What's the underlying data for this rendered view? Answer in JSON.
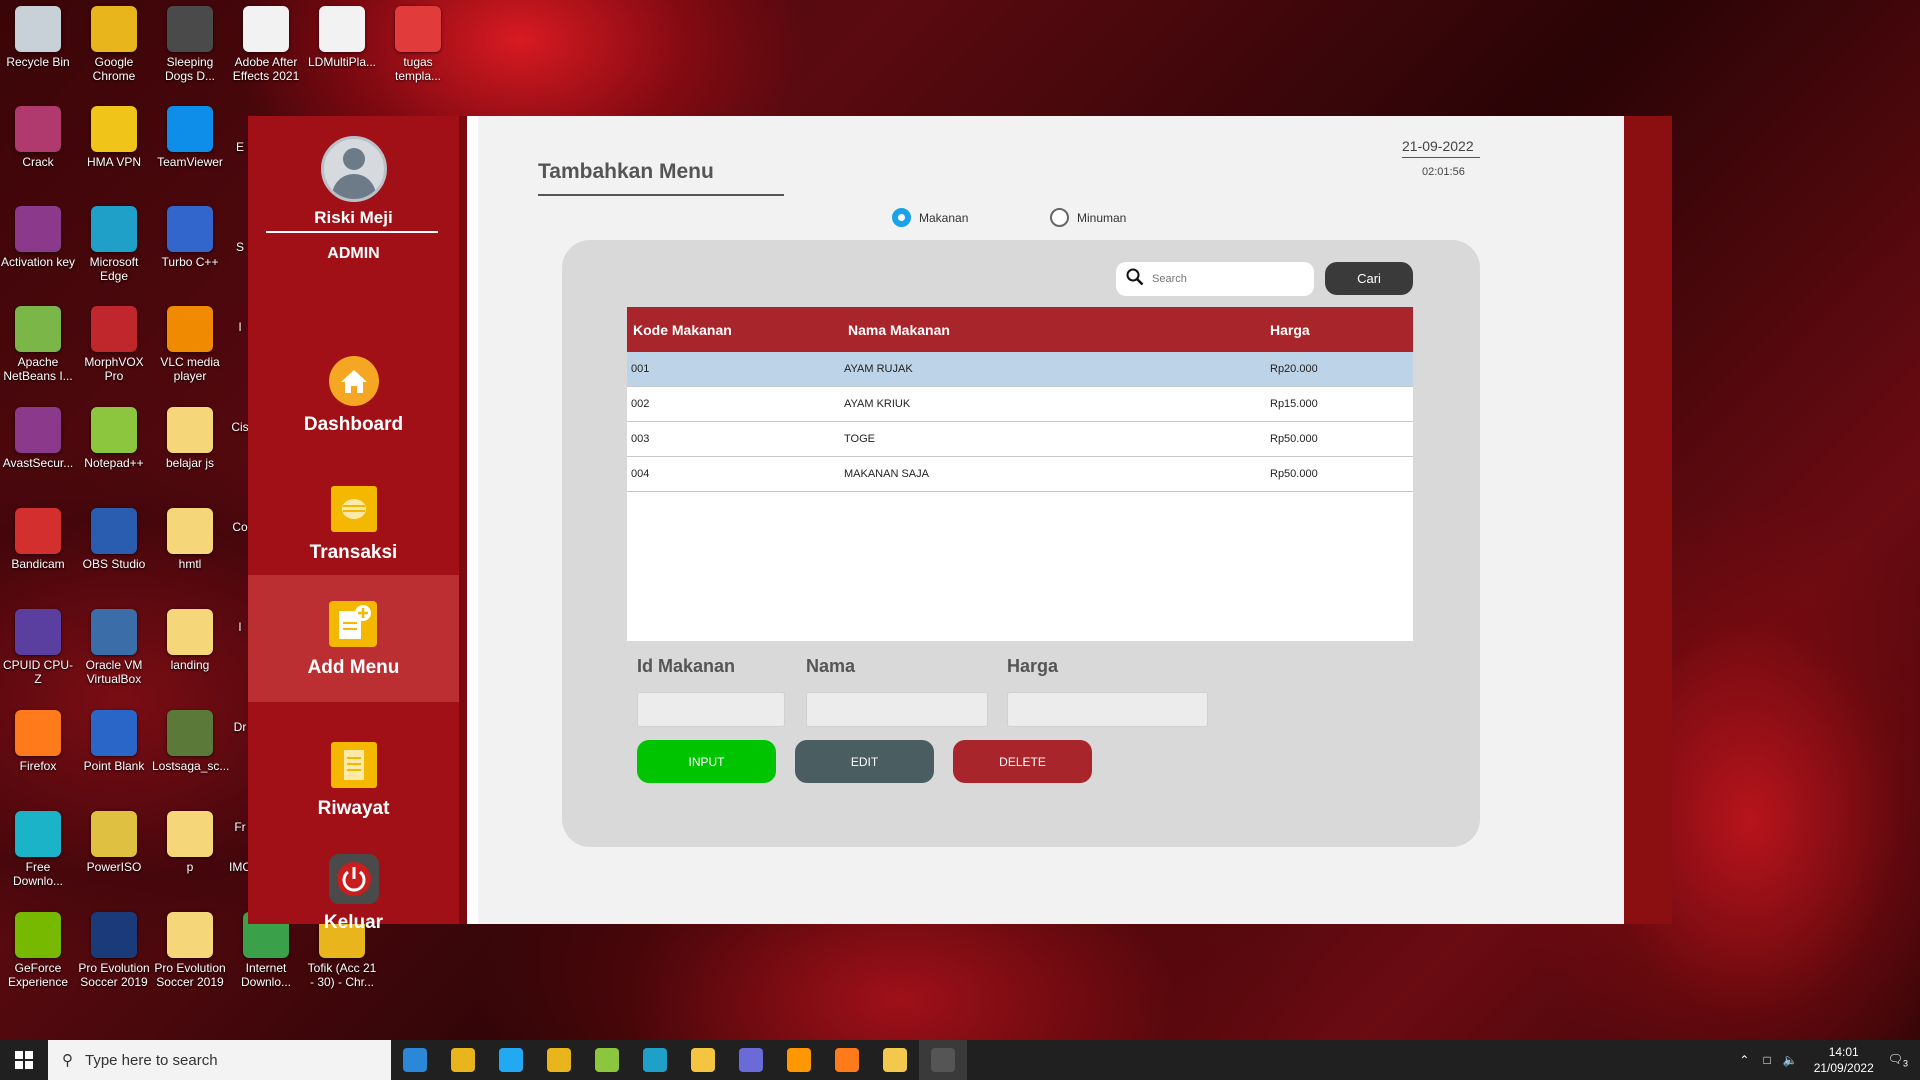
{
  "desktop": {
    "icons": [
      {
        "label": "Recycle Bin",
        "color": "#c8d0d8"
      },
      {
        "label": "Google Chrome",
        "color": "#e8b51c"
      },
      {
        "label": "Sleeping Dogs D...",
        "color": "#4a4a4a"
      },
      {
        "label": "Adobe After Effects 2021",
        "color": "#f2f2f2"
      },
      {
        "label": "LDMultiPla...",
        "color": "#f2f2f2"
      },
      {
        "label": "tugas templa...",
        "color": "#e23b3b"
      },
      {
        "label": "Crack",
        "color": "#b03a6e"
      },
      {
        "label": "HMA VPN",
        "color": "#f0c419"
      },
      {
        "label": "TeamViewer",
        "color": "#0e8ee9"
      },
      {
        "label": "Activation key",
        "color": "#8b3a8b"
      },
      {
        "label": "Microsoft Edge",
        "color": "#1fa0c9"
      },
      {
        "label": "Turbo C++",
        "color": "#3366cc"
      },
      {
        "label": "Apache NetBeans I...",
        "color": "#7ab648"
      },
      {
        "label": "MorphVOX Pro",
        "color": "#c0272d"
      },
      {
        "label": "VLC media player",
        "color": "#f08a00"
      },
      {
        "label": "AvastSecur...",
        "color": "#8b3a8b"
      },
      {
        "label": "Notepad++",
        "color": "#8cc63f"
      },
      {
        "label": "belajar js",
        "color": "#f5d77a"
      },
      {
        "label": "Bandicam",
        "color": "#d32f2f"
      },
      {
        "label": "OBS Studio",
        "color": "#2a5db0"
      },
      {
        "label": "hmtl",
        "color": "#f5d77a"
      },
      {
        "label": "CPUID CPU-Z",
        "color": "#5b3fa0"
      },
      {
        "label": "Oracle VM VirtualBox",
        "color": "#3b6ea8"
      },
      {
        "label": "landing",
        "color": "#f5d77a"
      },
      {
        "label": "Firefox",
        "color": "#ff7a1a"
      },
      {
        "label": "Point Blank",
        "color": "#2a66c8"
      },
      {
        "label": "Lostsaga_sc...",
        "color": "#5b7a3a"
      },
      {
        "label": "Free Downlo...",
        "color": "#1bb3c8"
      },
      {
        "label": "PowerISO",
        "color": "#e0c040"
      },
      {
        "label": "p",
        "color": "#f5d77a"
      },
      {
        "label": "GeForce Experience",
        "color": "#76b900"
      },
      {
        "label": "Pro Evolution Soccer 2019",
        "color": "#1a3a7a"
      },
      {
        "label": "Pro Evolution Soccer 2019",
        "color": "#f5d77a"
      },
      {
        "label": "Internet Downlo...",
        "color": "#3aa04a"
      },
      {
        "label": "Tofik (Acc 21 - 30) - Chr...",
        "color": "#e8b51c"
      }
    ],
    "partial_labels": [
      "E",
      "S",
      "I",
      "Cis",
      "Co",
      "l",
      "Dr",
      "Fr",
      "IMC"
    ]
  },
  "app": {
    "user": {
      "name": "Riski Meji",
      "role": "ADMIN"
    },
    "nav": [
      {
        "label": "Dashboard",
        "icon": "home-icon",
        "active": false
      },
      {
        "label": "Transaksi",
        "icon": "transaction-icon",
        "active": false
      },
      {
        "label": "Add Menu",
        "icon": "add-menu-icon",
        "active": true
      },
      {
        "label": "Riwayat",
        "icon": "history-icon",
        "active": false
      },
      {
        "label": "Keluar",
        "icon": "power-icon",
        "active": false
      }
    ],
    "page_title": "Tambahkan Menu",
    "date": "21-09-2022",
    "time": "02:01:56",
    "radio": {
      "makanan": "Makanan",
      "minuman": "Minuman",
      "selected": "Makanan"
    },
    "search": {
      "placeholder": "Search",
      "button": "Cari"
    },
    "table": {
      "headers": [
        "Kode Makanan",
        "Nama Makanan",
        "Harga"
      ],
      "rows": [
        [
          "001",
          "AYAM RUJAK",
          "Rp20.000"
        ],
        [
          "002",
          "AYAM KRIUK",
          "Rp15.000"
        ],
        [
          "003",
          "TOGE",
          "Rp50.000"
        ],
        [
          "004",
          "MAKANAN SAJA",
          "Rp50.000"
        ]
      ],
      "selected_row": 0
    },
    "form": {
      "id_label": "Id Makanan",
      "id_value": "",
      "nama_label": "Nama",
      "nama_value": "",
      "harga_label": "Harga",
      "harga_value": ""
    },
    "buttons": {
      "input": "INPUT",
      "edit": "EDIT",
      "delete": "DELETE"
    },
    "colors": {
      "sidebar": "#a01016",
      "active_nav": "#bb2f33",
      "header_row": "#a8262b",
      "input_btn": "#00c400",
      "edit_btn": "#4a5d61",
      "delete_btn": "#a8262b",
      "radio_checked": "#1aa3e8"
    }
  },
  "taskbar": {
    "search_placeholder": "Type here to search",
    "apps": [
      {
        "name": "mail-icon",
        "color": "#2b88d8"
      },
      {
        "name": "chrome-icon",
        "color": "#e8b51c"
      },
      {
        "name": "vscode-icon",
        "color": "#23a9f2"
      },
      {
        "name": "chrome-profile-icon",
        "color": "#e8b51c"
      },
      {
        "name": "notepadpp-icon",
        "color": "#8cc63f"
      },
      {
        "name": "edge-icon",
        "color": "#1fa0c9"
      },
      {
        "name": "explorer-icon",
        "color": "#f5c542"
      },
      {
        "name": "app-infinity-icon",
        "color": "#6a6ad8"
      },
      {
        "name": "sublime-icon",
        "color": "#ff9800"
      },
      {
        "name": "firefox-icon",
        "color": "#ff7a1a"
      },
      {
        "name": "git-icon",
        "color": "#f2c94c"
      },
      {
        "name": "java-app-icon",
        "color": "#555555"
      }
    ],
    "time": "14:01",
    "date": "21/09/2022",
    "notification_count": "3"
  }
}
